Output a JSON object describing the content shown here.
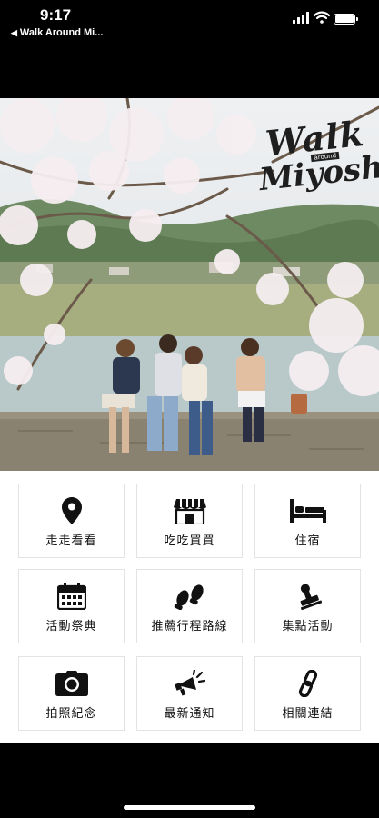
{
  "status_bar": {
    "time": "9:17",
    "back_app": "Walk Around Mi..."
  },
  "logo": {
    "line1": "Walk",
    "line2": "Miyoshi",
    "tag": "around"
  },
  "menu": {
    "items": [
      {
        "label": "走走看看",
        "icon": "map-pin-icon"
      },
      {
        "label": "吃吃買買",
        "icon": "storefront-icon"
      },
      {
        "label": "住宿",
        "icon": "bed-icon"
      },
      {
        "label": "活動祭典",
        "icon": "calendar-icon"
      },
      {
        "label": "推薦行程路線",
        "icon": "footprints-icon"
      },
      {
        "label": "集點活動",
        "icon": "stamp-icon"
      },
      {
        "label": "拍照紀念",
        "icon": "camera-icon"
      },
      {
        "label": "最新通知",
        "icon": "megaphone-icon"
      },
      {
        "label": "相關連結",
        "icon": "link-icon"
      }
    ]
  },
  "colors": {
    "background": "#000000",
    "panel": "#ffffff",
    "icon": "#111111",
    "tile_border": "#e3e3e3"
  }
}
